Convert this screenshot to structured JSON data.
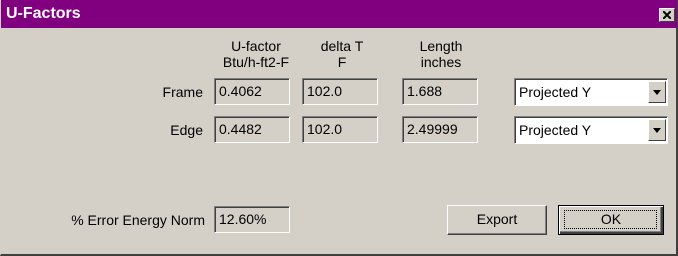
{
  "window": {
    "title": "U-Factors"
  },
  "headers": {
    "ufactor_line1": "U-factor",
    "ufactor_line2": "Btu/h-ft2-F",
    "deltat_line1": "delta T",
    "deltat_line2": "F",
    "length_line1": "Length",
    "length_line2": "inches"
  },
  "rows": [
    {
      "label": "Frame",
      "ufactor": "0.4062",
      "delta_t": "102.0",
      "length": "1.688",
      "projection": "Projected Y"
    },
    {
      "label": "Edge",
      "ufactor": "0.4482",
      "delta_t": "102.0",
      "length": "2.49999",
      "projection": "Projected Y"
    }
  ],
  "error": {
    "label": "% Error Energy Norm",
    "value": "12.60%"
  },
  "buttons": {
    "export_label": "Export",
    "ok_label": "OK"
  },
  "colors": {
    "titlebar": "#800080",
    "face": "#d4d0c8"
  }
}
